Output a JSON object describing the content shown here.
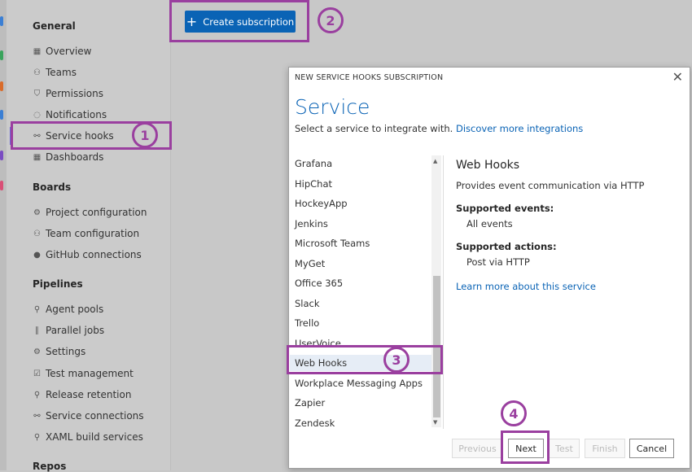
{
  "sidebar": {
    "sections": [
      {
        "title": "General",
        "items": [
          {
            "label": "Overview",
            "icon": "overview-icon"
          },
          {
            "label": "Teams",
            "icon": "teams-icon"
          },
          {
            "label": "Permissions",
            "icon": "permissions-icon"
          },
          {
            "label": "Notifications",
            "icon": "notifications-icon"
          },
          {
            "label": "Service hooks",
            "icon": "service-hooks-icon"
          },
          {
            "label": "Dashboards",
            "icon": "dashboards-icon"
          }
        ]
      },
      {
        "title": "Boards",
        "items": [
          {
            "label": "Project configuration",
            "icon": "project-config-icon"
          },
          {
            "label": "Team configuration",
            "icon": "team-config-icon"
          },
          {
            "label": "GitHub connections",
            "icon": "github-icon"
          }
        ]
      },
      {
        "title": "Pipelines",
        "items": [
          {
            "label": "Agent pools",
            "icon": "agent-pools-icon"
          },
          {
            "label": "Parallel jobs",
            "icon": "parallel-jobs-icon"
          },
          {
            "label": "Settings",
            "icon": "gear-icon"
          },
          {
            "label": "Test management",
            "icon": "test-management-icon"
          },
          {
            "label": "Release retention",
            "icon": "release-retention-icon"
          },
          {
            "label": "Service connections",
            "icon": "service-connections-icon"
          },
          {
            "label": "XAML build services",
            "icon": "xaml-build-icon"
          }
        ]
      },
      {
        "title": "Repos",
        "items": []
      }
    ]
  },
  "main": {
    "create_button_label": "Create subscription"
  },
  "annotations": [
    "1",
    "2",
    "3",
    "4"
  ],
  "dialog": {
    "header": "NEW SERVICE HOOKS SUBSCRIPTION",
    "title": "Service",
    "subtitle": "Select a service to integrate with.",
    "discover_link": "Discover more integrations",
    "services": [
      "Grafana",
      "HipChat",
      "HockeyApp",
      "Jenkins",
      "Microsoft Teams",
      "MyGet",
      "Office 365",
      "Slack",
      "Trello",
      "UserVoice",
      "Web Hooks",
      "Workplace Messaging Apps",
      "Zapier",
      "Zendesk"
    ],
    "selected_service": "Web Hooks",
    "detail": {
      "title": "Web Hooks",
      "description": "Provides event communication via HTTP",
      "events_label": "Supported events:",
      "events_value": "All events",
      "actions_label": "Supported actions:",
      "actions_value": "Post via HTTP",
      "learn_more": "Learn more about this service"
    },
    "buttons": {
      "previous": "Previous",
      "next": "Next",
      "test": "Test",
      "finish": "Finish",
      "cancel": "Cancel"
    }
  },
  "colors": {
    "accent": "#0a63b5",
    "highlight": "#9a3f9f"
  }
}
